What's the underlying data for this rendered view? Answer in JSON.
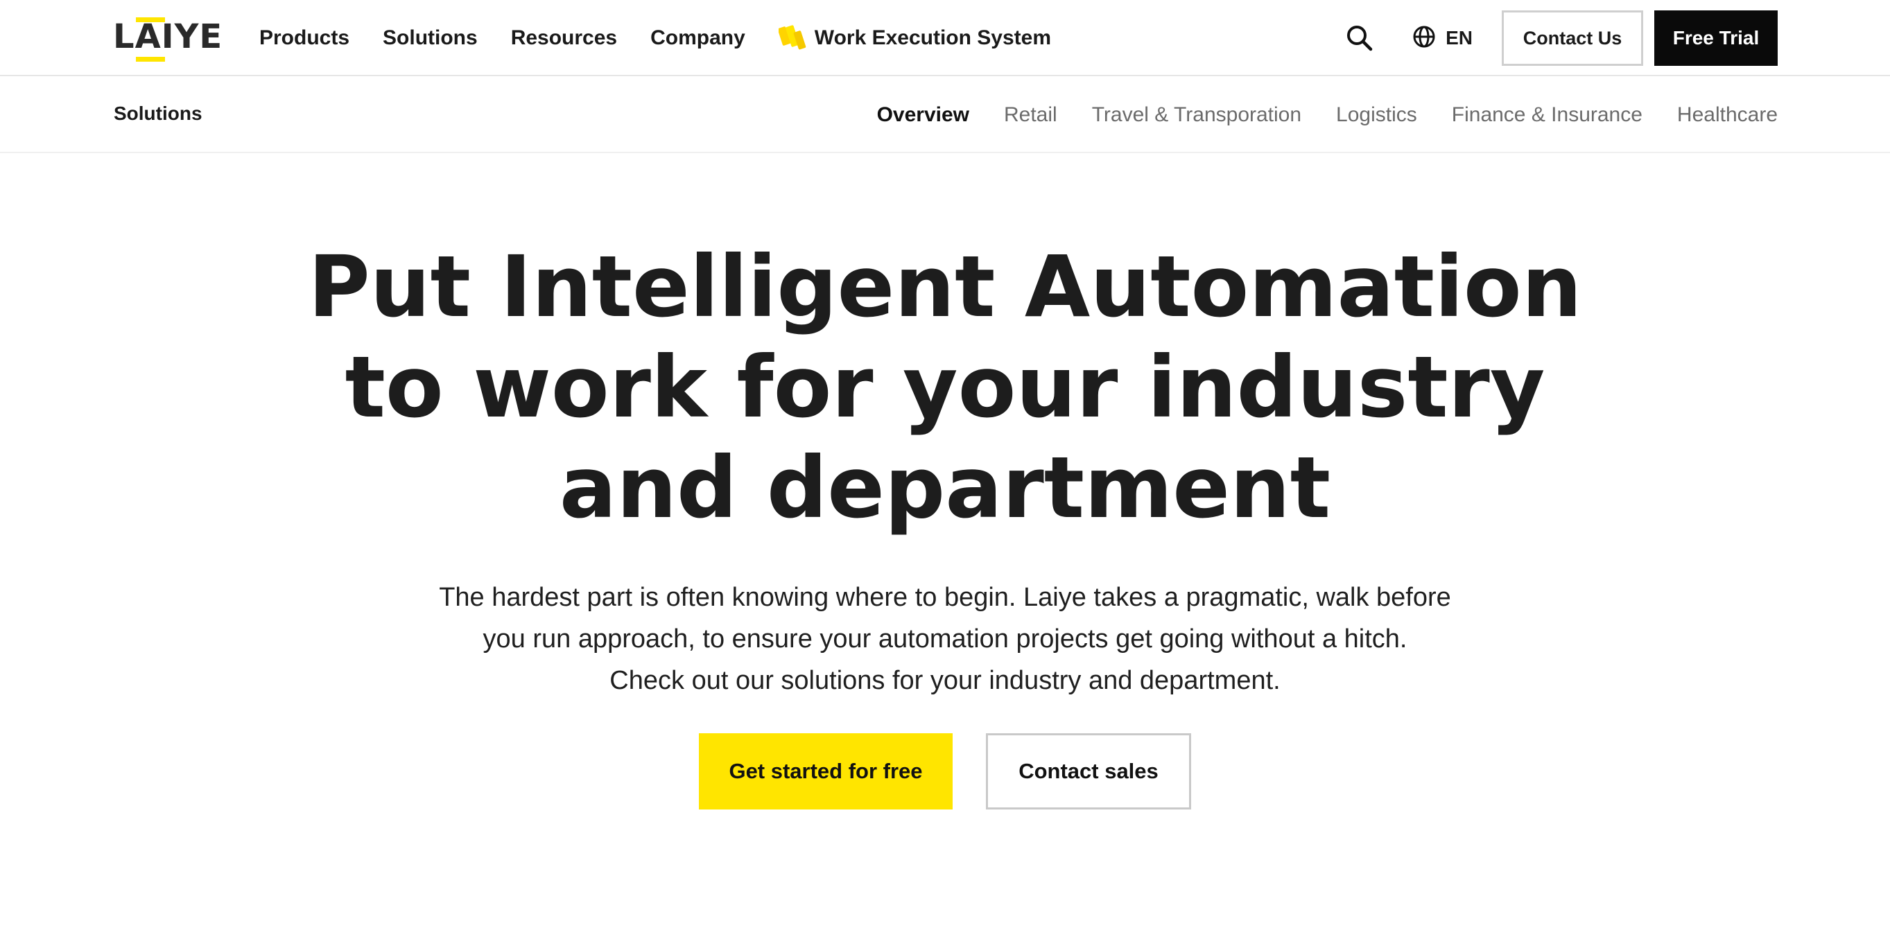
{
  "colors": {
    "accent_yellow": "#ffe500",
    "dark": "#0a0a0a",
    "text": "#1a1a1a",
    "muted": "#6b6b6b"
  },
  "header": {
    "logo_text": "LAIYE",
    "nav": [
      "Products",
      "Solutions",
      "Resources",
      "Company"
    ],
    "wes_label": "Work Execution System",
    "search_icon": "search-icon",
    "language_icon": "globe-icon",
    "language": "EN",
    "contact_label": "Contact Us",
    "trial_label": "Free Trial"
  },
  "subnav": {
    "title": "Solutions",
    "tabs": [
      "Overview",
      "Retail",
      "Travel & Transporation",
      "Logistics",
      "Finance & Insurance",
      "Healthcare"
    ],
    "active_tab": "Overview"
  },
  "hero": {
    "title_lines": [
      "Put Intelligent Automation",
      "to work for your industry",
      "and department"
    ],
    "subtitle_lines": [
      "The hardest part is often knowing where to begin. Laiye takes a pragmatic, walk before",
      "you run approach, to ensure your automation projects get going without a hitch.",
      "Check out our solutions for your industry and department."
    ],
    "primary_cta": "Get started for free",
    "secondary_cta": "Contact sales"
  }
}
